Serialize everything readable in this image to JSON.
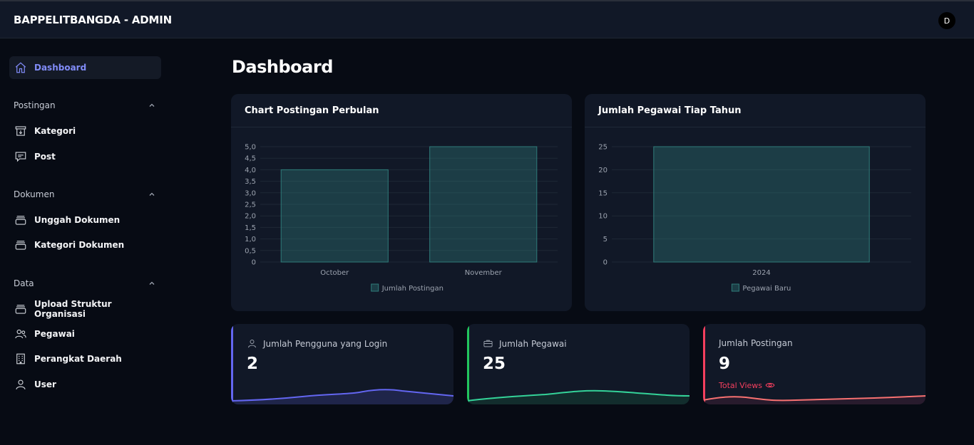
{
  "app": {
    "title": "BAPPELITBANGDA - ADMIN",
    "avatar_initial": "D"
  },
  "sidebar": {
    "dashboard": "Dashboard",
    "sections": [
      {
        "label": "Postingan",
        "items": [
          "Kategori",
          "Post"
        ]
      },
      {
        "label": "Dokumen",
        "items": [
          "Unggah Dokumen",
          "Kategori Dokumen"
        ]
      },
      {
        "label": "Data",
        "items": [
          "Upload Struktur Organisasi",
          "Pegawai",
          "Perangkat Daerah",
          "User"
        ]
      }
    ],
    "icons": [
      "home-icon",
      "download-box-icon",
      "message-icon",
      "archive-icon",
      "archive-icon",
      "archive-icon",
      "users-icon",
      "building-icon",
      "user-icon"
    ]
  },
  "main": {
    "title": "Dashboard",
    "charts": {
      "posts": {
        "title": "Chart Postingan Perbulan"
      },
      "employees": {
        "title": "Jumlah Pegawai Tiap Tahun"
      }
    },
    "stats": [
      {
        "label": "Jumlah Pengguna yang Login",
        "value": "2",
        "color": "#6366f1"
      },
      {
        "label": "Jumlah Pegawai",
        "value": "25",
        "color": "#22c55e"
      },
      {
        "label": "Jumlah Postingan",
        "value": "9",
        "link": "Total Views",
        "color": "#f43f5e"
      }
    ]
  },
  "chart_data": [
    {
      "type": "bar",
      "title": "Chart Postingan Perbulan",
      "categories": [
        "October",
        "November"
      ],
      "series": [
        {
          "name": "Jumlah Postingan",
          "values": [
            4,
            5
          ]
        }
      ],
      "ylim": [
        0,
        5
      ],
      "yticks": [
        "0",
        "0,5",
        "1,0",
        "1,5",
        "2,0",
        "2,5",
        "3,0",
        "3,5",
        "4,0",
        "4,5",
        "5,0"
      ],
      "legend": "bottom",
      "grid": true,
      "color": "#2f7c7a"
    },
    {
      "type": "bar",
      "title": "Jumlah Pegawai Tiap Tahun",
      "categories": [
        "2024"
      ],
      "series": [
        {
          "name": "Pegawai Baru",
          "values": [
            25
          ]
        }
      ],
      "ylim": [
        0,
        25
      ],
      "yticks": [
        "0",
        "5",
        "10",
        "15",
        "20",
        "25"
      ],
      "legend": "bottom",
      "grid": true,
      "color": "#2f7c7a"
    }
  ]
}
